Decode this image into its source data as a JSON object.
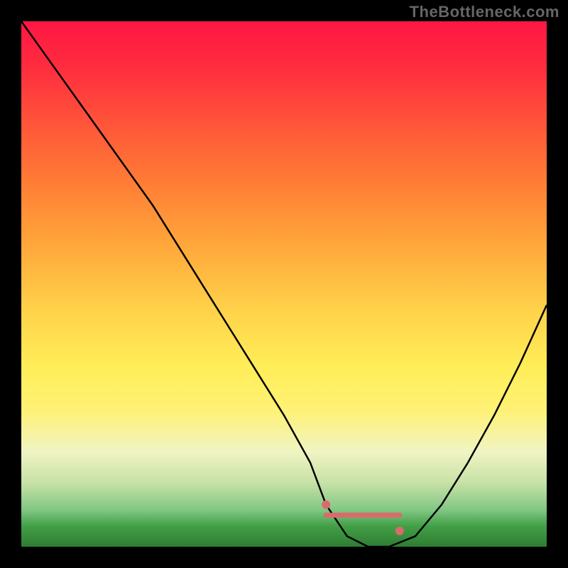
{
  "attribution": "TheBottleneck.com",
  "colors": {
    "background": "#000000",
    "curve_stroke": "#000000",
    "marker_fill": "#d96b6b",
    "attribution_text": "#666666"
  },
  "chart_data": {
    "type": "line",
    "title": "",
    "xlabel": "",
    "ylabel": "",
    "xlim": [
      0,
      100
    ],
    "ylim": [
      0,
      100
    ],
    "x": [
      0,
      5,
      10,
      15,
      20,
      25,
      30,
      35,
      40,
      45,
      50,
      55,
      58,
      62,
      66,
      70,
      75,
      80,
      85,
      90,
      95,
      100
    ],
    "values": [
      100,
      93,
      86,
      79,
      72,
      65,
      57,
      49,
      41,
      33,
      25,
      16,
      8,
      2,
      0,
      0,
      2,
      8,
      16,
      25,
      35,
      46
    ],
    "note": "V-shaped bottleneck curve. Y=0 (bottom) is the optimal/green zone; higher y = worse (red). Flat minimum roughly over x≈62–72.",
    "optimal_range": {
      "x_start": 58,
      "x_end": 72,
      "y": 6
    },
    "markers": [
      {
        "x": 58,
        "y": 8
      },
      {
        "x": 72,
        "y": 3
      }
    ]
  }
}
